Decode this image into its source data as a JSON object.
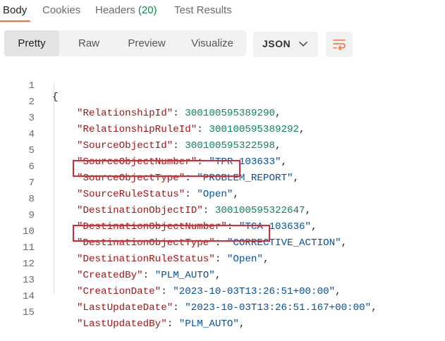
{
  "tabs": [
    {
      "label": "Body"
    },
    {
      "label": "Cookies"
    },
    {
      "label": "Headers",
      "count": "(20)"
    },
    {
      "label": "Test Results"
    }
  ],
  "view_modes": [
    "Pretty",
    "Raw",
    "Preview",
    "Visualize"
  ],
  "active_view": "Pretty",
  "format": "JSON",
  "code": {
    "open_brace": "{",
    "lines": [
      {
        "num": "1"
      },
      {
        "num": "2",
        "key": "\"RelationshipId\"",
        "value": "300100595389290",
        "type": "num"
      },
      {
        "num": "3",
        "key": "\"RelationshipRuleId\"",
        "value": "300100595389292",
        "type": "num"
      },
      {
        "num": "4",
        "key": "\"SourceObjectId\"",
        "value": "300100595322598",
        "type": "num"
      },
      {
        "num": "5",
        "key": "\"SourceObjectNumber\"",
        "value": "\"TPR 103633\"",
        "type": "str"
      },
      {
        "num": "6",
        "key": "\"SourceObjectType\"",
        "value": "\"PROBLEM_REPORT\"",
        "type": "str"
      },
      {
        "num": "7",
        "key": "\"SourceRuleStatus\"",
        "value": "\"Open\"",
        "type": "str",
        "highlighted": true
      },
      {
        "num": "8",
        "key": "\"DestinationObjectID\"",
        "value": "300100595322647",
        "type": "num"
      },
      {
        "num": "9",
        "key": "\"DestinationObjectNumber\"",
        "value": "\"TCA 103636\"",
        "type": "str"
      },
      {
        "num": "10",
        "key": "\"DestinationObjectType\"",
        "value": "\"CORRECTIVE_ACTION\"",
        "type": "str"
      },
      {
        "num": "11",
        "key": "\"DestinationRuleStatus\"",
        "value": "\"Open\"",
        "type": "str",
        "highlighted": true
      },
      {
        "num": "12",
        "key": "\"CreatedBy\"",
        "value": "\"PLM_AUTO\"",
        "type": "str"
      },
      {
        "num": "13",
        "key": "\"CreationDate\"",
        "value": "\"2023-10-03T13:26:51+00:00\"",
        "type": "str"
      },
      {
        "num": "14",
        "key": "\"LastUpdateDate\"",
        "value": "\"2023-10-03T13:26:51.167+00:00\"",
        "type": "str"
      },
      {
        "num": "15",
        "key": "\"LastUpdatedBy\"",
        "value": "\"PLM_AUTO\"",
        "type": "str"
      }
    ]
  },
  "colors": {
    "accent": "#ff6c37",
    "highlight_box": "#e0262f",
    "json_key": "#a31515",
    "json_number": "#098658",
    "json_string": "#0451a5"
  },
  "icons": {
    "format_dropdown": "chevron-down-icon",
    "wrap": "wrap-lines-icon"
  }
}
